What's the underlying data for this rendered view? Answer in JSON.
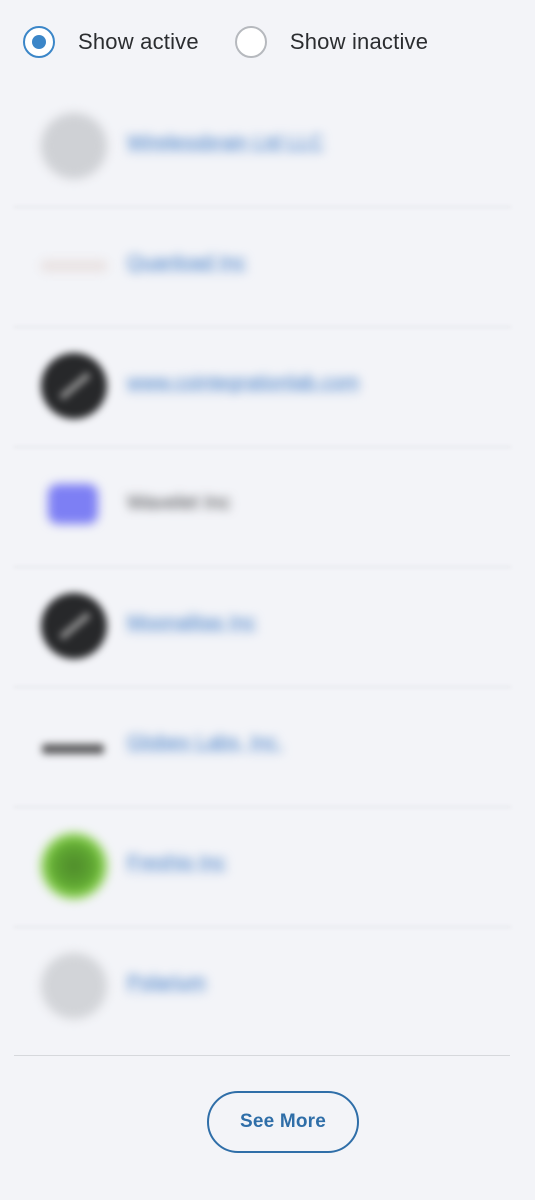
{
  "filters": {
    "options": [
      {
        "label": "Show active",
        "selected": true
      },
      {
        "label": "Show inactive",
        "selected": false
      }
    ]
  },
  "list": {
    "items": [
      {
        "name": "Wirelessbrain Ltd LLC",
        "logo": "grey-circle-logo",
        "link": true
      },
      {
        "name": "Quanload Inc",
        "logo": "faint-wordmark-logo",
        "link": true
      },
      {
        "name": "www.cointegrationlab.com",
        "logo": "dark-circle-logo",
        "link": true
      },
      {
        "name": "Wavelet Inc",
        "logo": "purple-square-logo",
        "link": false
      },
      {
        "name": "Moonalitas Inc",
        "logo": "dark-circle-logo",
        "link": true
      },
      {
        "name": "Globex Labs, Inc.",
        "logo": "dark-wordmark-logo",
        "link": true
      },
      {
        "name": "Freshio Inc",
        "logo": "green-circle-logo",
        "link": true
      },
      {
        "name": "Polarium",
        "logo": "light-grey-circle-logo",
        "link": true
      }
    ]
  },
  "see_more": {
    "label": "See More"
  },
  "colors": {
    "accent": "#3b86c8",
    "button": "#2f6ea8",
    "background": "#f3f4f8",
    "link": "#3a77c4"
  }
}
